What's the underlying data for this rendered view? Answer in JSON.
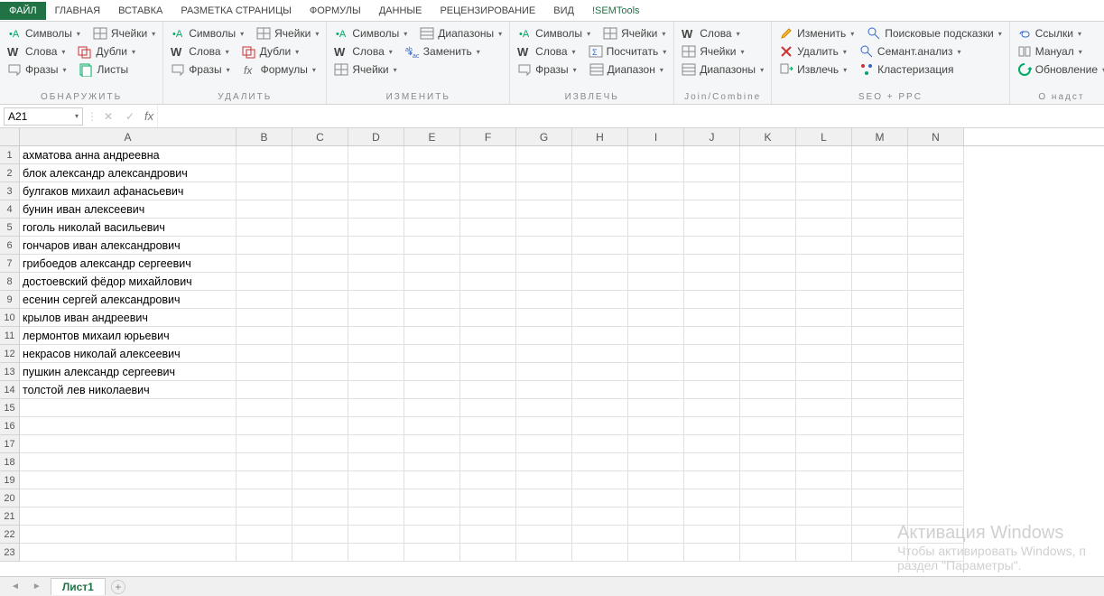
{
  "menu": {
    "file": "ФАЙЛ",
    "home": "ГЛАВНАЯ",
    "insert": "ВСТАВКА",
    "layout": "РАЗМЕТКА СТРАНИЦЫ",
    "formulas": "ФОРМУЛЫ",
    "data": "ДАННЫЕ",
    "review": "РЕЦЕНЗИРОВАНИЕ",
    "view": "ВИД",
    "sem": "!SEMTools"
  },
  "ribbon": {
    "detect": {
      "symbols": "Символы",
      "words": "Слова",
      "phrases": "Фразы",
      "cells": "Ячейки",
      "dupes": "Дубли",
      "sheets": "Листы",
      "label": "ОБНАРУЖИТЬ"
    },
    "delete": {
      "symbols": "Символы",
      "words": "Слова",
      "phrases": "Фразы",
      "cells": "Ячейки",
      "dupes": "Дубли",
      "formulas": "Формулы",
      "label": "УДАЛИТЬ"
    },
    "change": {
      "symbols": "Символы",
      "words": "Слова",
      "cells": "Ячейки",
      "range": "Диапазоны",
      "replace": "Заменить",
      "cells2": "Ячейки",
      "label": "ИЗМЕНИТЬ"
    },
    "extract": {
      "symbols": "Символы",
      "words": "Слова",
      "phrases": "Фразы",
      "cells": "Ячейки",
      "count": "Посчитать",
      "range": "Диапазон",
      "label": "ИЗВЛЕЧЬ"
    },
    "join": {
      "words": "Слова",
      "cells": "Ячейки",
      "ranges": "Диапазоны",
      "label": "Join/Combine"
    },
    "seo": {
      "edit": "Изменить",
      "del": "Удалить",
      "ext": "Извлечь",
      "hints": "Поисковые подсказки",
      "sem": "Семант.анализ",
      "cluster": "Кластеризация",
      "label": "SEO + PPC"
    },
    "about": {
      "links": "Ссылки",
      "manual": "Мануал",
      "update": "Обновление",
      "label": "О надст"
    }
  },
  "namebox": "A21",
  "columns": [
    "A",
    "B",
    "C",
    "D",
    "E",
    "F",
    "G",
    "H",
    "I",
    "J",
    "K",
    "L",
    "M",
    "N"
  ],
  "rows": [
    "ахматова анна андреевна",
    "блок александр александрович",
    "булгаков михаил афанасьевич",
    "бунин иван алексеевич",
    "гоголь николай васильевич",
    "гончаров иван александрович",
    "грибоедов александр сергеевич",
    "достоевский фёдор михайлович",
    "есенин сергей александрович",
    "крылов иван андреевич",
    "лермонтов михаил юрьевич",
    "некрасов николай алексеевич",
    "пушкин александр сергеевич",
    "толстой лев николаевич",
    "",
    "",
    "",
    "",
    "",
    "",
    "",
    "",
    ""
  ],
  "sheet": "Лист1",
  "watermark": {
    "t1": "Активация Windows",
    "t2": "Чтобы активировать Windows, п",
    "t3": "раздел \"Параметры\"."
  }
}
